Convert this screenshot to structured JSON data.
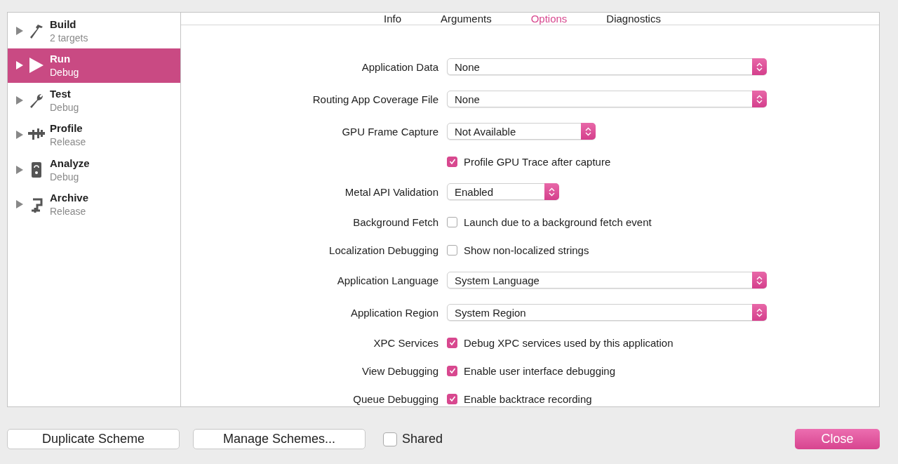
{
  "sidebar": {
    "items": [
      {
        "title": "Build",
        "subtitle": "2 targets",
        "selected": false
      },
      {
        "title": "Run",
        "subtitle": "Debug",
        "selected": true
      },
      {
        "title": "Test",
        "subtitle": "Debug",
        "selected": false
      },
      {
        "title": "Profile",
        "subtitle": "Release",
        "selected": false
      },
      {
        "title": "Analyze",
        "subtitle": "Debug",
        "selected": false
      },
      {
        "title": "Archive",
        "subtitle": "Release",
        "selected": false
      }
    ]
  },
  "tabs": [
    {
      "label": "Info",
      "selected": false
    },
    {
      "label": "Arguments",
      "selected": false
    },
    {
      "label": "Options",
      "selected": true
    },
    {
      "label": "Diagnostics",
      "selected": false
    }
  ],
  "settings": [
    {
      "kind": "popup",
      "label": "Application Data",
      "value": "None"
    },
    {
      "kind": "popup",
      "label": "Routing App Coverage File",
      "value": "None"
    },
    {
      "kind": "popup",
      "label": "GPU Frame Capture",
      "value": "Not Available"
    },
    {
      "kind": "checkbox",
      "text": "Profile GPU Trace after capture",
      "checked": true
    },
    {
      "kind": "popup",
      "label": "Metal API Validation",
      "value": "Enabled"
    },
    {
      "kind": "checkbox",
      "label": "Background Fetch",
      "text": "Launch due to a background fetch event",
      "checked": false
    },
    {
      "kind": "checkbox",
      "label": "Localization Debugging",
      "text": "Show non-localized strings",
      "checked": false
    },
    {
      "kind": "popup",
      "label": "Application Language",
      "value": "System Language"
    },
    {
      "kind": "popup",
      "label": "Application Region",
      "value": "System Region"
    },
    {
      "kind": "checkbox",
      "label": "XPC Services",
      "text": "Debug XPC services used by this application",
      "checked": true
    },
    {
      "kind": "checkbox",
      "label": "View Debugging",
      "text": "Enable user interface debugging",
      "checked": true
    },
    {
      "kind": "checkbox",
      "label": "Queue Debugging",
      "text": "Enable backtrace recording",
      "checked": true
    }
  ],
  "footer": {
    "duplicate": "Duplicate Scheme",
    "manage": "Manage Schemes...",
    "shared": {
      "label": "Shared",
      "checked": false
    },
    "close": "Close"
  }
}
